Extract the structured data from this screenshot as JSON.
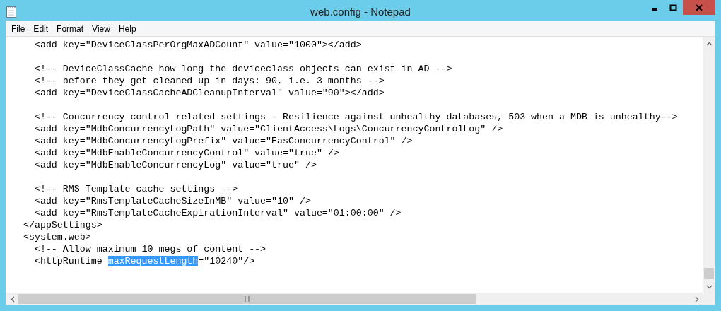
{
  "window": {
    "title": "web.config - Notepad"
  },
  "menu": [
    {
      "parts": [
        {
          "text": "F",
          "underlined": true
        },
        {
          "text": "ile",
          "underlined": false
        }
      ]
    },
    {
      "parts": [
        {
          "text": "E",
          "underlined": true
        },
        {
          "text": "dit",
          "underlined": false
        }
      ]
    },
    {
      "parts": [
        {
          "text": "F",
          "underlined": false
        },
        {
          "text": "o",
          "underlined": true
        },
        {
          "text": "rmat",
          "underlined": false
        }
      ]
    },
    {
      "parts": [
        {
          "text": "V",
          "underlined": true
        },
        {
          "text": "iew",
          "underlined": false
        }
      ]
    },
    {
      "parts": [
        {
          "text": "H",
          "underlined": true
        },
        {
          "text": "elp",
          "underlined": false
        }
      ]
    }
  ],
  "lines": [
    {
      "text": "    <add key=\"DeviceClassPerOrgMaxADCount\" value=\"1000\"></add>"
    },
    {
      "text": "    <!-- DeviceClassCache how long the deviceclass objects can exist in AD -->",
      "blank_line_before": true
    },
    {
      "text": "    <!-- before they get cleaned up in days: 90, i.e. 3 months -->"
    },
    {
      "text": "    <add key=\"DeviceClassCacheADCleanupInterval\" value=\"90\"></add>"
    },
    {
      "text": "    <!-- Concurrency control related settings - Resilience against unhealthy databases, 503 when a MDB is unhealthy-->",
      "blank_line_before": true
    },
    {
      "text": "    <add key=\"MdbConcurrencyLogPath\" value=\"ClientAccess\\Logs\\ConcurrencyControlLog\" />"
    },
    {
      "text": "    <add key=\"MdbConcurrencyLogPrefix\" value=\"EasConcurrencyControl\" />"
    },
    {
      "text": "    <add key=\"MdbEnableConcurrencyControl\" value=\"true\" />"
    },
    {
      "text": "    <add key=\"MdbEnableConcurrencyLog\" value=\"true\" />"
    },
    {
      "text": "    <!-- RMS Template cache settings -->",
      "blank_line_before": true
    },
    {
      "text": "    <add key=\"RmsTemplateCacheSizeInMB\" value=\"10\" />"
    },
    {
      "text": "    <add key=\"RmsTemplateCacheExpirationInterval\" value=\"01:00:00\" />"
    },
    {
      "text": "  </appSettings>"
    },
    {
      "text": "  <system.web>"
    },
    {
      "text": "    <!-- Allow maximum 10 megs of content -->"
    },
    {
      "segments": [
        {
          "text": "    <httpRuntime ",
          "selected": false
        },
        {
          "text": "maxRequestLength",
          "selected": true
        },
        {
          "text": "=\"10240\"/>",
          "selected": false
        }
      ]
    }
  ]
}
